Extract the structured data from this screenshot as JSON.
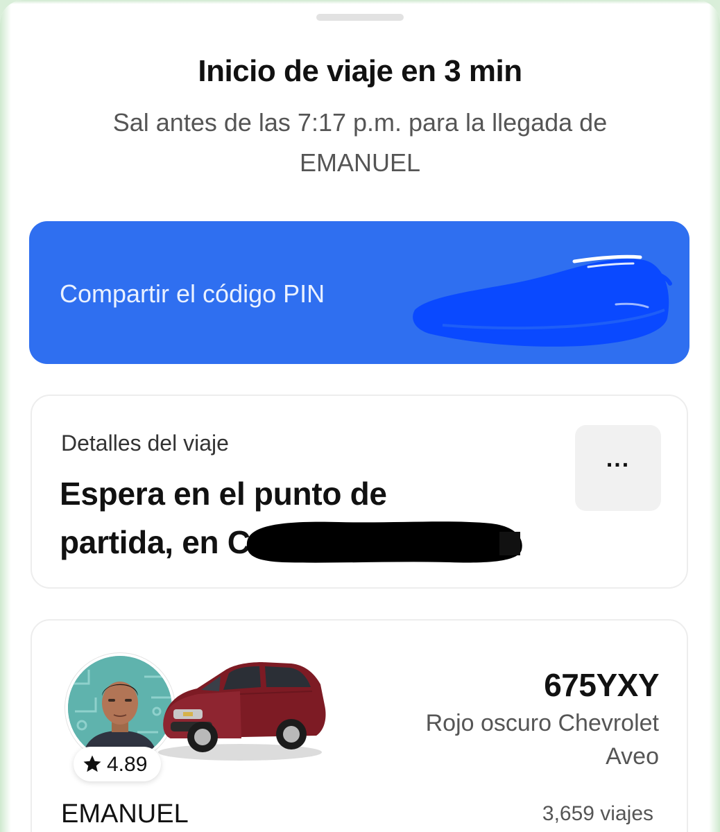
{
  "header": {
    "title": "Inicio de viaje en 3 min",
    "subtitle": "Sal antes de las 7:17 p.m. para la llegada de EMANUEL"
  },
  "pin": {
    "label": "Compartir el código PIN"
  },
  "trip_details": {
    "label": "Detalles del viaje",
    "address": "Espera en el punto de partida, en C",
    "more_icon": "more-horizontal-icon",
    "more_label": "..."
  },
  "driver": {
    "rating": "4.89",
    "name": "EMANUEL",
    "trips": "3,659 viajes"
  },
  "vehicle": {
    "plate": "675YXY",
    "description": "Rojo oscuro Chevrolet Aveo"
  },
  "colors": {
    "accent": "#2f6ff0",
    "background_tint": "#d9eed9",
    "car": "#7d1b24",
    "redaction_black": "#000000",
    "redaction_blue": "#0a49ff"
  }
}
